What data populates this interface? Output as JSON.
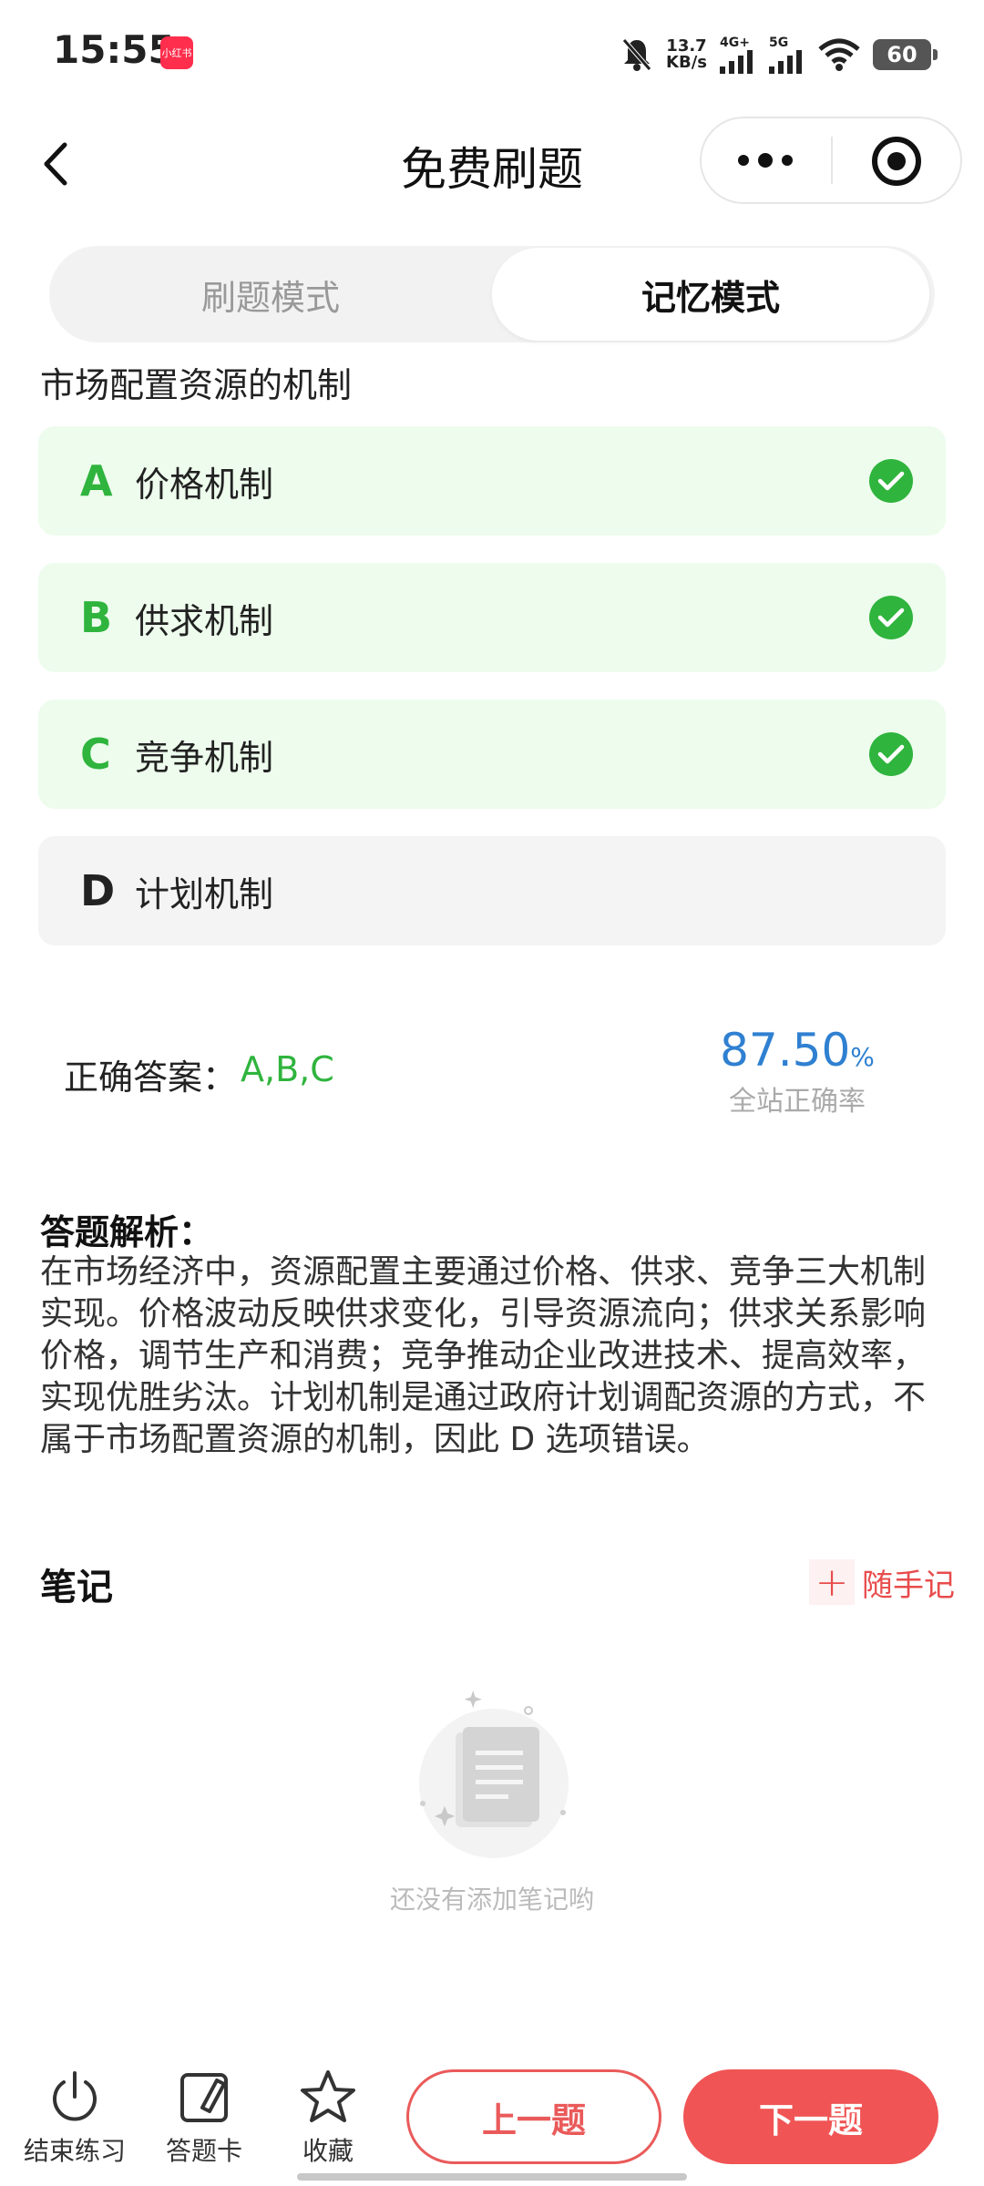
{
  "status_bar": {
    "time": "15:55",
    "app_badge": "小红书",
    "net_speed_value": "13.7",
    "net_speed_unit": "KB/s",
    "net_type_1": "4G+",
    "net_type_2": "5G",
    "battery": "60"
  },
  "header": {
    "title": "免费刷题"
  },
  "mode_tabs": {
    "practice": "刷题模式",
    "memory": "记忆模式"
  },
  "question": {
    "text": "市场配置资源的机制",
    "options": [
      {
        "letter": "A",
        "text": "价格机制",
        "correct": true
      },
      {
        "letter": "B",
        "text": "供求机制",
        "correct": true
      },
      {
        "letter": "C",
        "text": "竞争机制",
        "correct": true
      },
      {
        "letter": "D",
        "text": "计划机制",
        "correct": false
      }
    ]
  },
  "answer": {
    "label": "正确答案：",
    "value": "A,B,C",
    "rate": "87.50",
    "rate_unit": "%",
    "rate_label": "全站正确率"
  },
  "analysis": {
    "title": "答题解析：",
    "body": "在市场经济中，资源配置主要通过价格、供求、竞争三大机制实现。价格波动反映供求变化，引导资源流向；供求关系影响价格，调节生产和消费；竞争推动企业改进技术、提高效率，实现优胜劣汰。计划机制是通过政府计划调配资源的方式，不属于市场配置资源的机制，因此 D 选项错误。"
  },
  "notes": {
    "title": "笔记",
    "add_label": "随手记",
    "empty_text": "还没有添加笔记哟"
  },
  "bottom_bar": {
    "end_practice": "结束练习",
    "answer_card": "答题卡",
    "favorite": "收藏",
    "prev": "上一题",
    "next": "下一题"
  },
  "colors": {
    "correct_green": "#2fb43d",
    "correct_bg": "#edfced",
    "accent_red": "#f05454",
    "rate_blue": "#2f80d1"
  }
}
